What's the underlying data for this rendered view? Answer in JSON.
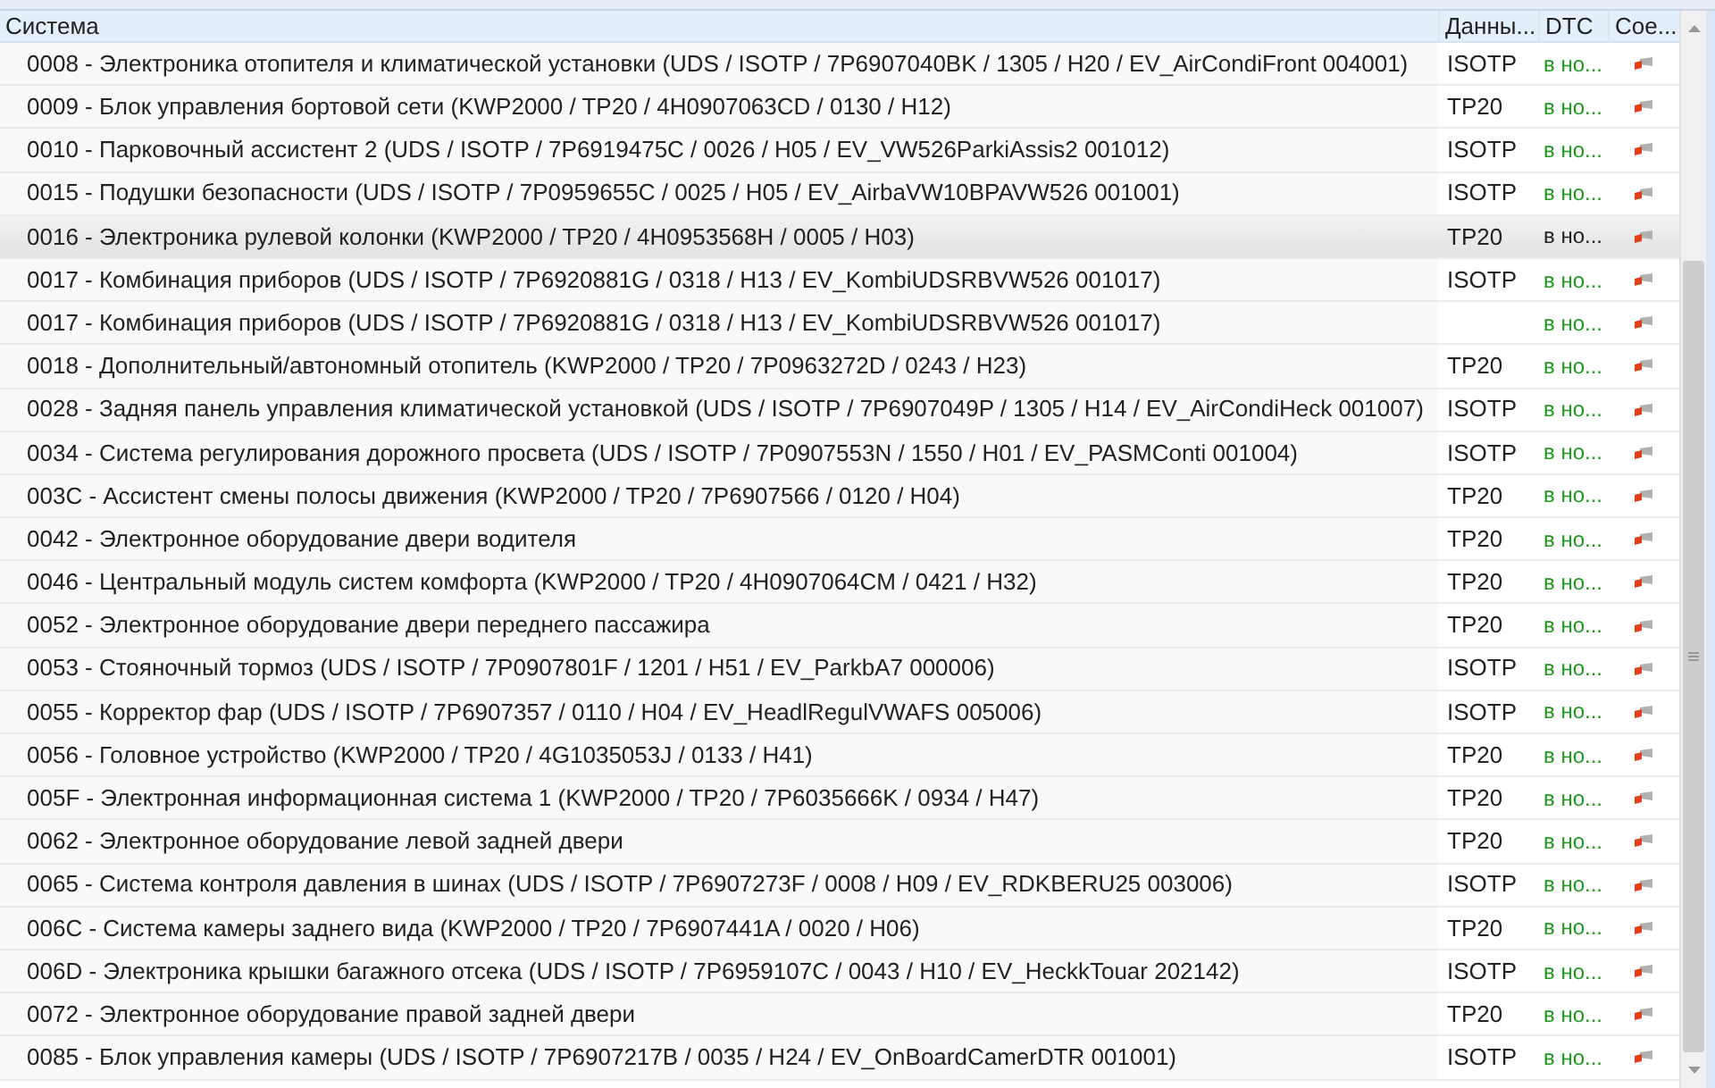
{
  "table": {
    "columns": [
      {
        "label": "Система"
      },
      {
        "label": "Данны..."
      },
      {
        "label": "DTC"
      },
      {
        "label": "Сое..."
      }
    ],
    "rows": [
      {
        "system": "0008 - Электроника отопителя и климатической установки  (UDS / ISOTP / 7P6907040BK / 1305 / H20 / EV_AirCondiFront 004001)",
        "data": "ISOTP",
        "dtc": "в но...",
        "selected": false
      },
      {
        "system": "0009 - Блок управления бортовой сети  (KWP2000 / TP20 / 4H0907063CD / 0130 / H12)",
        "data": "TP20",
        "dtc": "в но...",
        "selected": false
      },
      {
        "system": "0010 - Парковочный ассистент 2  (UDS / ISOTP / 7P6919475C / 0026 / H05 / EV_VW526ParkiAssis2 001012)",
        "data": "ISOTP",
        "dtc": "в но...",
        "selected": false
      },
      {
        "system": "0015 - Подушки безопасности  (UDS / ISOTP / 7P0959655C / 0025 / H05 / EV_AirbaVW10BPAVW526 001001)",
        "data": "ISOTP",
        "dtc": "в но...",
        "selected": false
      },
      {
        "system": "0016 - Электроника рулевой колонки  (KWP2000 / TP20 / 4H0953568H / 0005 / H03)",
        "data": "TP20",
        "dtc": "в но...",
        "selected": true
      },
      {
        "system": "0017 - Комбинация приборов  (UDS / ISOTP / 7P6920881G / 0318 / H13 / EV_KombiUDSRBVW526 001017)",
        "data": "ISOTP",
        "dtc": "в но...",
        "selected": false
      },
      {
        "system": "0017 - Комбинация приборов  (UDS / ISOTP / 7P6920881G / 0318 / H13 / EV_KombiUDSRBVW526 001017)",
        "dtc": "в но...",
        "selected": false
      },
      {
        "system": "0018 - Дополнительный/автономный отопитель  (KWP2000 / TP20 / 7P0963272D / 0243 / H23)",
        "data": "TP20",
        "dtc": "в но...",
        "selected": false
      },
      {
        "system": "0028 - Задняя панель управления климатической установкой  (UDS / ISOTP / 7P6907049P / 1305 / H14 / EV_AirCondiHeck 001007)",
        "data": "ISOTP",
        "dtc": "в но...",
        "selected": false
      },
      {
        "system": "0034 - Система регулирования дорожного просвета  (UDS / ISOTP / 7P0907553N / 1550 / H01 / EV_PASMConti 001004)",
        "data": "ISOTP",
        "dtc": "в но...",
        "selected": false
      },
      {
        "system": "003C - Ассистент смены полосы движения  (KWP2000 / TP20 / 7P6907566 / 0120 / H04)",
        "data": "TP20",
        "dtc": "в но...",
        "selected": false
      },
      {
        "system": "0042 - Электронное оборудование двери водителя",
        "data": "TP20",
        "dtc": "в но...",
        "selected": false
      },
      {
        "system": "0046 - Центральный модуль систем комфорта  (KWP2000 / TP20 / 4H0907064CM / 0421 / H32)",
        "data": "TP20",
        "dtc": "в но...",
        "selected": false
      },
      {
        "system": "0052 - Электронное оборудование двери переднего пассажира",
        "data": "TP20",
        "dtc": "в но...",
        "selected": false
      },
      {
        "system": "0053 - Стояночный тормоз  (UDS / ISOTP / 7P0907801F / 1201 / H51 / EV_ParkbA7 000006)",
        "data": "ISOTP",
        "dtc": "в но...",
        "selected": false
      },
      {
        "system": "0055 - Корректор фар  (UDS / ISOTP / 7P6907357 / 0110 / H04 / EV_HeadlRegulVWAFS 005006)",
        "data": "ISOTP",
        "dtc": "в но...",
        "selected": false
      },
      {
        "system": "0056 - Головное устройство  (KWP2000 / TP20 / 4G1035053J / 0133 / H41)",
        "data": "TP20",
        "dtc": "в но...",
        "selected": false
      },
      {
        "system": "005F - Электронная информационная система 1  (KWP2000 / TP20 / 7P6035666K / 0934 / H47)",
        "data": "TP20",
        "dtc": "в но...",
        "selected": false
      },
      {
        "system": "0062 - Электронное оборудование левой задней двери",
        "data": "TP20",
        "dtc": "в но...",
        "selected": false
      },
      {
        "system": "0065 - Система контроля давления в шинах  (UDS / ISOTP / 7P6907273F / 0008 / H09 / EV_RDKBERU25 003006)",
        "data": "ISOTP",
        "dtc": "в но...",
        "selected": false
      },
      {
        "system": "006C - Система камеры заднего вида  (KWP2000 / TP20 / 7P6907441A / 0020 / H06)",
        "data": "TP20",
        "dtc": "в но...",
        "selected": false
      },
      {
        "system": "006D - Электроника крышки багажного отсека  (UDS / ISOTP / 7P6959107C / 0043 / H10 / EV_HeckkTouar 202142)",
        "data": "ISOTP",
        "dtc": "в но...",
        "selected": false
      },
      {
        "system": "0072 - Электронное оборудование правой задней двери",
        "data": "TP20",
        "dtc": "в но...",
        "selected": false
      },
      {
        "system": "0085 - Блок управления камеры  (UDS / ISOTP / 7P6907217B / 0035 / H24 / EV_OnBoardCamerDTR 001001)",
        "data": "ISOTP",
        "dtc": "в но...",
        "selected": false
      }
    ]
  }
}
